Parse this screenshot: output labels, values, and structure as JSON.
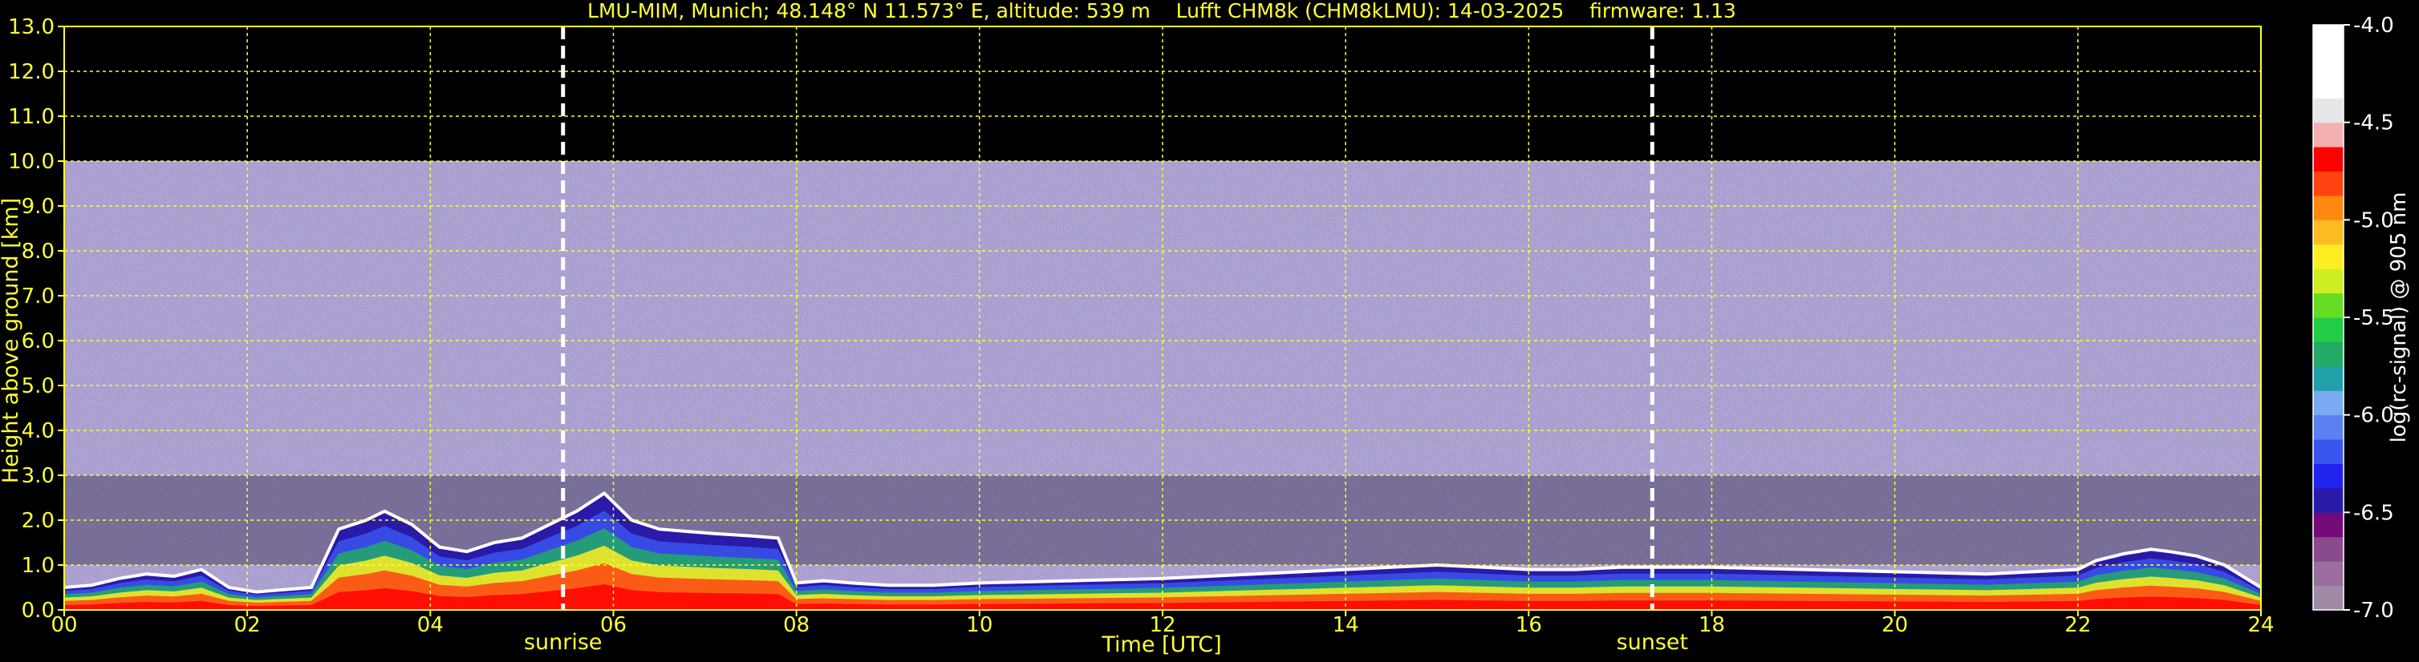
{
  "chart_data": {
    "type": "heatmap",
    "title": "LMU-MIM, Munich; 48.148° N 11.573° E, altitude: 539 m    Lufft CHM8k (CHM8kLMU): 14-03-2025    firmware: 1.13",
    "xlabel": "Time [UTC]",
    "ylabel": "Height above ground [km]",
    "xlim": [
      0,
      24
    ],
    "ylim": [
      0,
      13
    ],
    "x_ticks": [
      "00",
      "02",
      "04",
      "06",
      "08",
      "10",
      "12",
      "14",
      "16",
      "18",
      "20",
      "22",
      "24"
    ],
    "y_ticks": [
      "0.0",
      "1.0",
      "2.0",
      "3.0",
      "4.0",
      "5.0",
      "6.0",
      "7.0",
      "8.0",
      "9.0",
      "10.0",
      "11.0",
      "12.0",
      "13.0"
    ],
    "grid": true,
    "measurement_top_km": 10.0,
    "markers": [
      {
        "label": "sunrise",
        "time_h": 5.45
      },
      {
        "label": "sunset",
        "time_h": 17.35
      }
    ],
    "colorbar": {
      "label": "log(rc-signal) @ 905 nm",
      "range": [
        -7.0,
        -4.0
      ],
      "ticks": [
        "-4.0",
        "-4.5",
        "-5.0",
        "-5.5",
        "-6.0",
        "-6.5",
        "-7.0"
      ],
      "colors": [
        "#a08aa6",
        "#9a6e9e",
        "#8a4a8e",
        "#740a78",
        "#2a1aa8",
        "#2222ee",
        "#3a55ee",
        "#5a80f2",
        "#7aaaf2",
        "#22a0aa",
        "#22aa66",
        "#22cc44",
        "#66dd22",
        "#ccee22",
        "#ffee22",
        "#ffbb22",
        "#ff8811",
        "#ff4411",
        "#ff0000",
        "#f4b0b0",
        "#e6e6e6",
        "#ffffff",
        "#ffffff",
        "#ffffff"
      ]
    },
    "cloud_top_profile": {
      "time_h": [
        0.0,
        0.3,
        0.6,
        0.9,
        1.2,
        1.5,
        1.8,
        2.1,
        2.4,
        2.7,
        3.0,
        3.3,
        3.5,
        3.8,
        4.1,
        4.4,
        4.7,
        5.0,
        5.3,
        5.6,
        5.9,
        6.2,
        6.5,
        6.8,
        7.1,
        7.5,
        7.8,
        8.0,
        8.3,
        8.6,
        9.0,
        9.5,
        10.0,
        11.0,
        12.0,
        13.0,
        14.0,
        14.5,
        15.0,
        15.5,
        16.0,
        16.5,
        17.0,
        17.4,
        18.0,
        19.0,
        20.0,
        21.0,
        21.5,
        22.0,
        22.2,
        22.5,
        22.8,
        23.0,
        23.3,
        23.6,
        24.0
      ],
      "height_km": [
        0.5,
        0.55,
        0.7,
        0.8,
        0.75,
        0.9,
        0.5,
        0.4,
        0.45,
        0.5,
        1.8,
        2.0,
        2.2,
        1.9,
        1.4,
        1.3,
        1.5,
        1.6,
        1.9,
        2.2,
        2.6,
        2.0,
        1.8,
        1.75,
        1.7,
        1.65,
        1.6,
        0.6,
        0.65,
        0.6,
        0.55,
        0.55,
        0.6,
        0.65,
        0.7,
        0.8,
        0.9,
        0.95,
        1.0,
        0.95,
        0.9,
        0.9,
        0.95,
        0.95,
        0.95,
        0.9,
        0.85,
        0.8,
        0.85,
        0.9,
        1.1,
        1.25,
        1.35,
        1.3,
        1.2,
        1.0,
        0.5
      ]
    }
  }
}
